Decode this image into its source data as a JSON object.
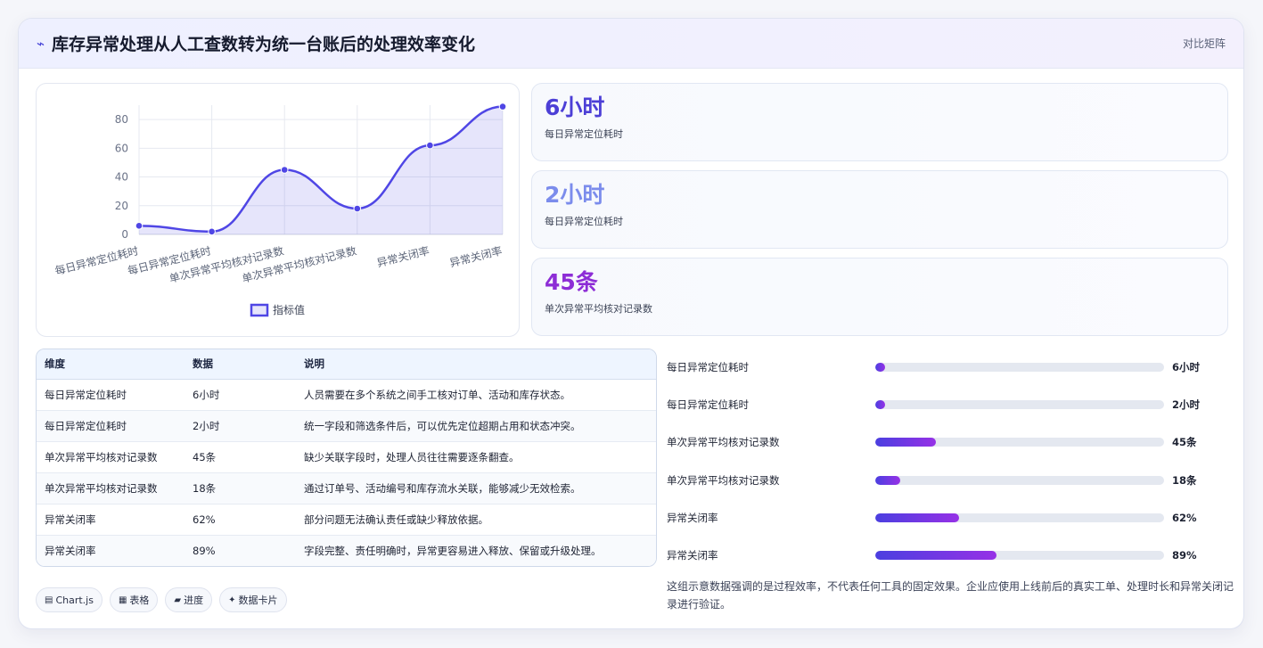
{
  "header": {
    "icon": "trend-icon",
    "title": "库存异常处理从人工查数转为统一台账后的处理效率变化",
    "right_label": "对比矩阵"
  },
  "chart_data": {
    "type": "line",
    "categories": [
      "每日异常定位耗时",
      "每日异常定位耗时",
      "单次异常平均核对记录数",
      "单次异常平均核对记录数",
      "异常关闭率",
      "异常关闭率"
    ],
    "series": [
      {
        "name": "指标值",
        "values": [
          6,
          2,
          45,
          18,
          62,
          89
        ]
      }
    ],
    "y_ticks": [
      "0",
      "20",
      "40",
      "60",
      "80"
    ],
    "ylim": [
      0,
      90
    ],
    "grid": true,
    "legend": "bottom",
    "color": "#4f46e5"
  },
  "kpis": [
    {
      "value": "6小时",
      "label": "每日异常定位耗时",
      "color": "#4c3fd6"
    },
    {
      "value": "2小时",
      "label": "每日异常定位耗时",
      "color": "#7b8cec"
    },
    {
      "value": "45条",
      "label": "单次异常平均核对记录数",
      "color": "#8d2dd6"
    }
  ],
  "table": {
    "headers": [
      "维度",
      "数据",
      "说明"
    ],
    "rows": [
      [
        "每日异常定位耗时",
        "6小时",
        "人员需要在多个系统之间手工核对订单、活动和库存状态。"
      ],
      [
        "每日异常定位耗时",
        "2小时",
        "统一字段和筛选条件后，可以优先定位超期占用和状态冲突。"
      ],
      [
        "单次异常平均核对记录数",
        "45条",
        "缺少关联字段时，处理人员往往需要逐条翻查。"
      ],
      [
        "单次异常平均核对记录数",
        "18条",
        "通过订单号、活动编号和库存流水关联，能够减少无效检索。"
      ],
      [
        "异常关闭率",
        "62%",
        "部分问题无法确认责任或缺少释放依据。"
      ],
      [
        "异常关闭率",
        "89%",
        "字段完整、责任明确时，异常更容易进入释放、保留或升级处理。"
      ]
    ]
  },
  "progress": [
    {
      "label": "每日异常定位耗时",
      "value": "6小时",
      "fraction": 0.034
    },
    {
      "label": "每日异常定位耗时",
      "value": "2小时",
      "fraction": 0.034
    },
    {
      "label": "单次异常平均核对记录数",
      "value": "45条",
      "fraction": 0.21
    },
    {
      "label": "单次异常平均核对记录数",
      "value": "18条",
      "fraction": 0.085
    },
    {
      "label": "异常关闭率",
      "value": "62%",
      "fraction": 0.29
    },
    {
      "label": "异常关闭率",
      "value": "89%",
      "fraction": 0.42
    }
  ],
  "chips": [
    {
      "icon": "chart-icon",
      "glyph": "▤",
      "label": "Chart.js"
    },
    {
      "icon": "table-icon",
      "glyph": "▦",
      "label": "表格"
    },
    {
      "icon": "progress-icon",
      "glyph": "▰",
      "label": "进度"
    },
    {
      "icon": "sparkle-icon",
      "glyph": "✦",
      "label": "数据卡片"
    }
  ],
  "note": "这组示意数据强调的是过程效率，不代表任何工具的固定效果。企业应使用上线前后的真实工单、处理时长和异常关闭记录进行验证。"
}
